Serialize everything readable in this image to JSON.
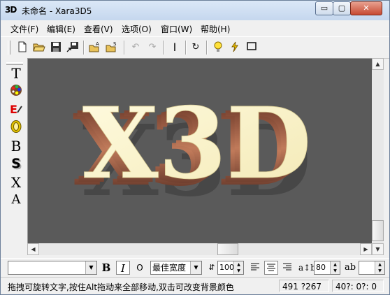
{
  "window": {
    "app_icon": "3D",
    "title": "未命名 - Xara3D5",
    "controls": {
      "minimize": "▭",
      "maximize": "▢",
      "close": "✕"
    }
  },
  "menu": [
    {
      "label": "文件(F)"
    },
    {
      "label": "编辑(E)"
    },
    {
      "label": "查看(V)"
    },
    {
      "label": "选项(O)"
    },
    {
      "label": "窗口(W)"
    },
    {
      "label": "帮助(H)"
    }
  ],
  "toolbar": {
    "icons": [
      "new-file-icon",
      "open-file-icon",
      "save-icon",
      "export-icon",
      "open-animation-icon",
      "open-style-icon",
      "undo-icon",
      "redo-icon",
      "text-cursor-icon",
      "rotate-icon",
      "light-icon",
      "animation-icon",
      "frame-icon"
    ]
  },
  "left_tools": {
    "text_tool": "T",
    "color_tool": "color-palette-icon",
    "texture_tool": "texture-icon",
    "bevel_tool": "bevel-icon",
    "outline_tool": "B",
    "shadow_tool": "S",
    "extrude_tool": "X",
    "font_tool": "A"
  },
  "canvas": {
    "text": "X3D",
    "background_color": "#5a5a5a",
    "text_color": "#fcf6cf"
  },
  "text_toolbar": {
    "font_name": "",
    "bold": "B",
    "italic": "I",
    "outline_font": "O",
    "spacing_option": "最佳宽度",
    "letter_spacing": "100",
    "line_spacing": "80",
    "align_left": "left-align-icon",
    "align_center": "center-align-icon",
    "align_right": "right-align-icon",
    "last_spin": ""
  },
  "status": {
    "message": "拖拽可旋转文字,按住Alt拖动来全部移动,双击可改变背景颜色",
    "coords": "491 ?267",
    "frames": "40?: 0?: 0"
  }
}
